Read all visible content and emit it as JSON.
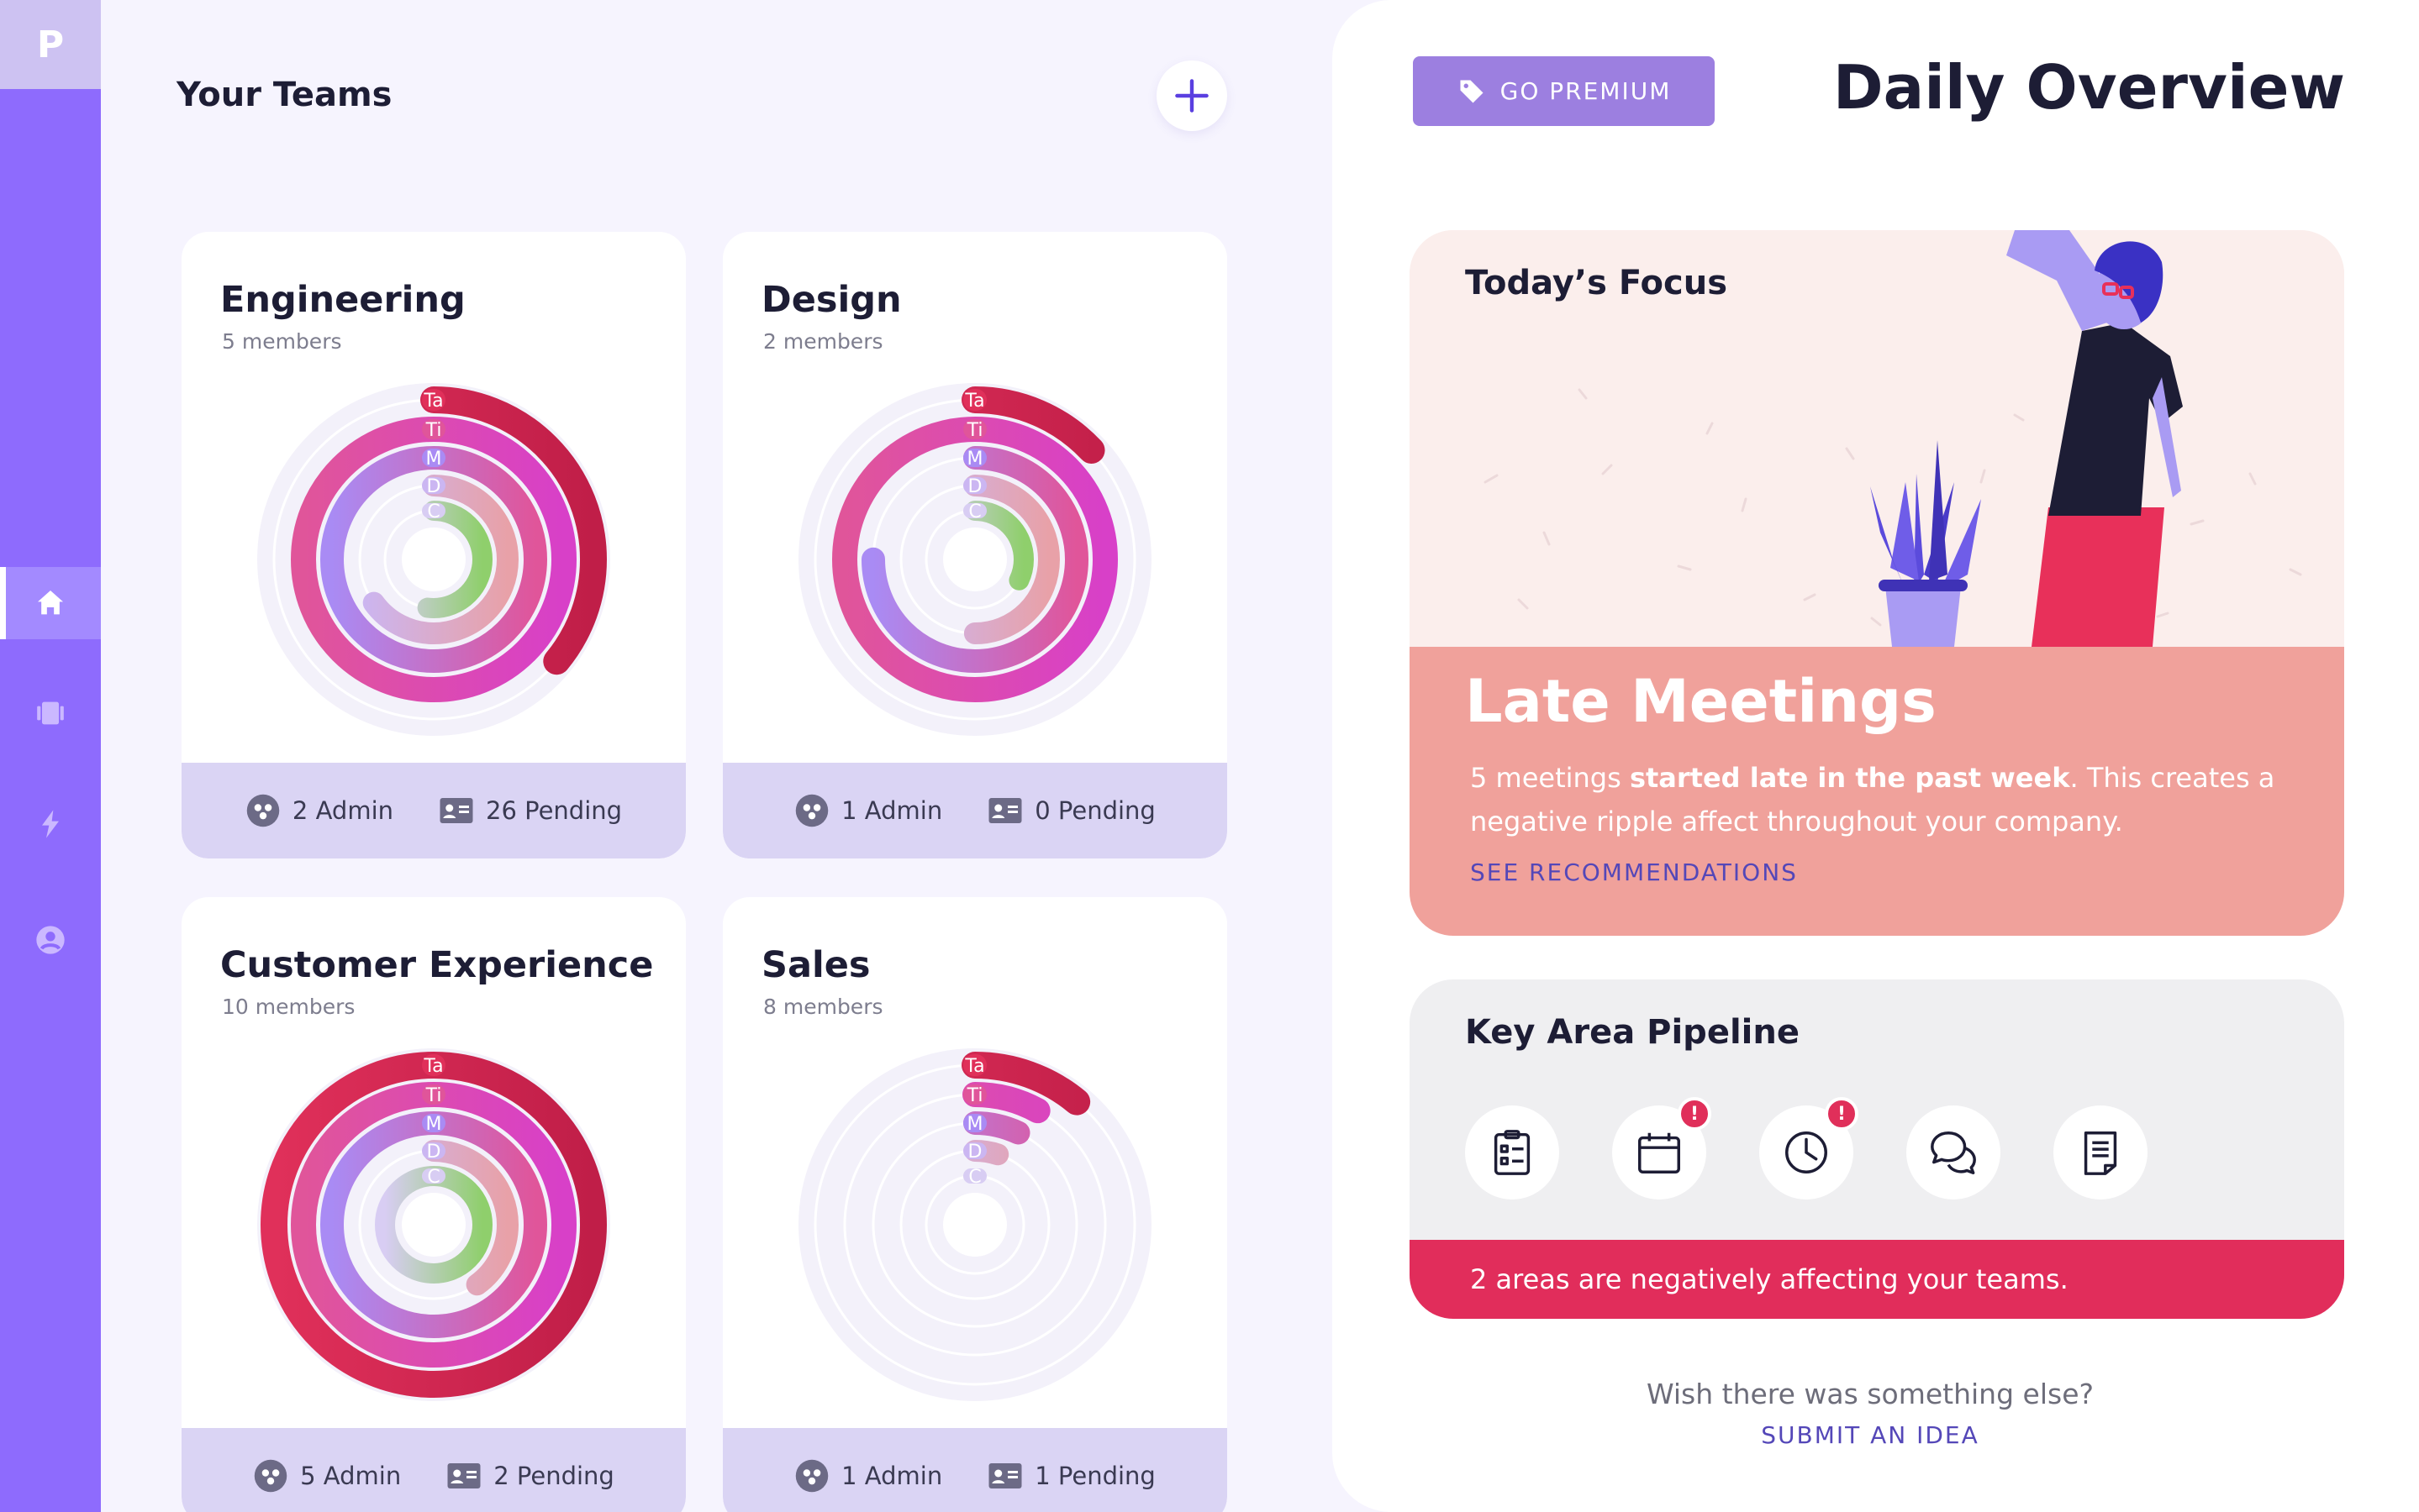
{
  "sidebar": {
    "logo": "P",
    "items": [
      {
        "name": "home-icon",
        "active": true
      },
      {
        "name": "cards-icon",
        "active": false
      },
      {
        "name": "bolt-icon",
        "active": false
      },
      {
        "name": "user-icon",
        "active": false
      }
    ]
  },
  "teams": {
    "title": "Your Teams",
    "add_label": "+",
    "ring_labels": [
      "Ta",
      "Ti",
      "M",
      "D",
      "C"
    ],
    "cards": [
      {
        "name": "Engineering",
        "members": "5 members",
        "admin": "2 Admin",
        "pending": "26 Pending",
        "rings": [
          0.36,
          1.0,
          1.0,
          0.65,
          0.52
        ]
      },
      {
        "name": "Design",
        "members": "2 members",
        "admin": "1 Admin",
        "pending": "0 Pending",
        "rings": [
          0.13,
          1.0,
          0.75,
          0.5,
          0.32
        ]
      },
      {
        "name": "Customer Experience",
        "members": "10 members",
        "admin": "5 Admin",
        "pending": "2 Pending",
        "rings": [
          1.0,
          1.0,
          1.0,
          0.4,
          1.0
        ]
      },
      {
        "name": "Sales",
        "members": "8 members",
        "admin": "1 Admin",
        "pending": "1 Pending",
        "rings": [
          0.11,
          0.08,
          0.07,
          0.05,
          0.0
        ]
      }
    ]
  },
  "header": {
    "premium_label": "GO PREMIUM",
    "title": "Daily Overview"
  },
  "focus": {
    "label": "Today’s Focus",
    "headline": "Late Meetings",
    "desc_pre": "5 meetings ",
    "desc_bold": "started late in the past week",
    "desc_post": ". This creates a negative ripple affect throughout your company.",
    "link": "SEE RECOMMENDATIONS"
  },
  "pipeline": {
    "title": "Key Area Pipeline",
    "icons": [
      {
        "name": "checklist-icon",
        "alert": false
      },
      {
        "name": "calendar-icon",
        "alert": true
      },
      {
        "name": "clock-icon",
        "alert": true
      },
      {
        "name": "chat-icon",
        "alert": false
      },
      {
        "name": "document-icon",
        "alert": false
      }
    ],
    "alert_mark": "!",
    "banner": "2 areas are negatively affecting your teams."
  },
  "footer": {
    "question": "Wish there was something else?",
    "link": "SUBMIT AN IDEA"
  },
  "colors": {
    "sidebar": "#8e6bfd",
    "ring_ta": "#e0305a",
    "ring_ti": "#e0559a",
    "ring_m": "#a98bf4",
    "ring_d": "#cbb6f2",
    "ring_c": "#d8cdf3",
    "focus_bottom": "#f0a19b",
    "alert": "#e12d5b"
  }
}
